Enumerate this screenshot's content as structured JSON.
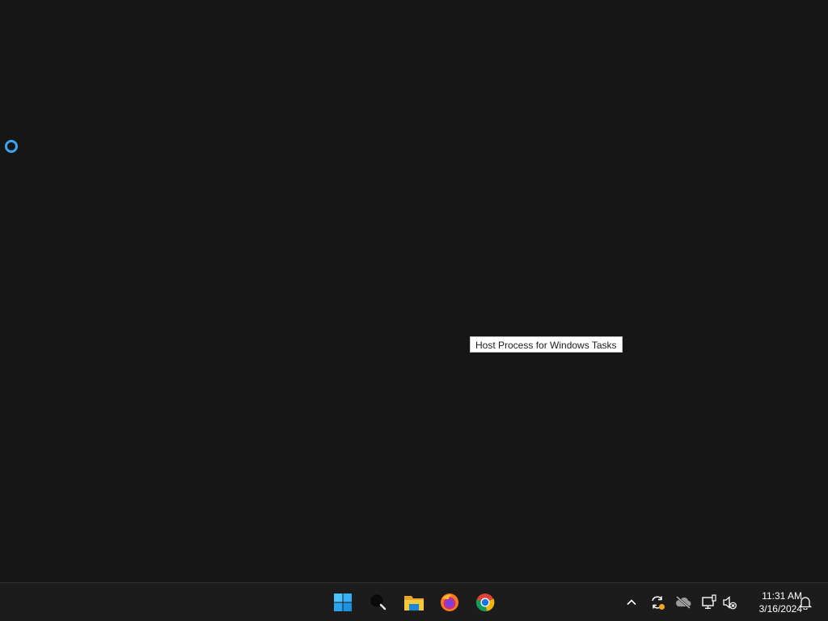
{
  "desktop": {
    "tooltip": "Host Process for Windows Tasks",
    "cursor_icon": "busy-ring-icon"
  },
  "taskbar": {
    "apps": [
      {
        "name": "start",
        "icon": "windows-logo-icon"
      },
      {
        "name": "search",
        "icon": "search-icon"
      },
      {
        "name": "file-explorer",
        "icon": "folder-icon"
      },
      {
        "name": "firefox",
        "icon": "firefox-icon"
      },
      {
        "name": "chrome",
        "icon": "chrome-icon"
      }
    ],
    "tray": {
      "icons": [
        "chevron-up-icon",
        "sync-warning-icon",
        "onedrive-offline-icon",
        "network-icon",
        "volume-muted-icon"
      ],
      "time": "11:31 AM",
      "date": "3/16/2024",
      "notification_icon": "bell-icon"
    }
  },
  "colors": {
    "desktop_bg": "#161616",
    "taskbar_bg": "#1c1c1c",
    "accent_blue": "#3ea6f0"
  }
}
